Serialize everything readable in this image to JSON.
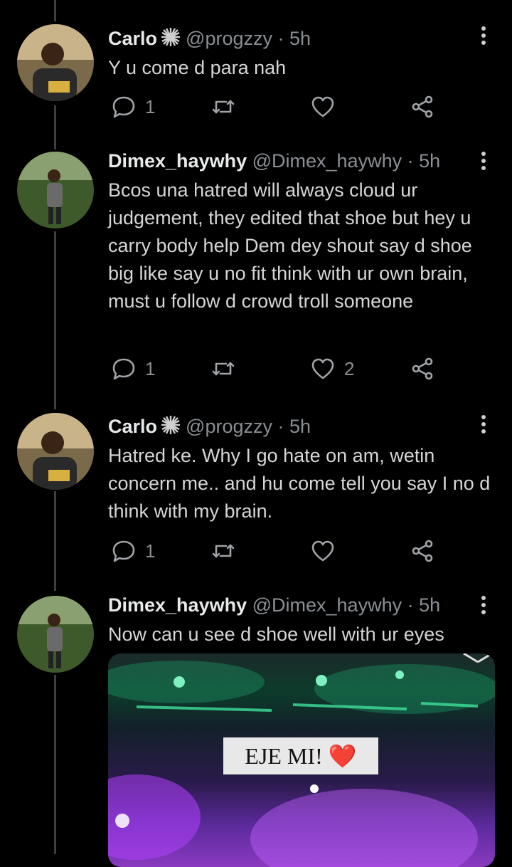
{
  "tweets": [
    {
      "name": "Carlo",
      "handle": "@progzzy",
      "time": "· 5h",
      "text": "Y u come d para nah",
      "replies": "1",
      "retweets": "",
      "likes": ""
    },
    {
      "name": "Dimex_haywhy",
      "handle": "@Dimex_haywhy",
      "time": "· 5h",
      "text": "Bcos una hatred will always cloud ur judgement, they edited that shoe but hey u carry body help Dem dey shout say d shoe big like say u no fit think with ur own brain, must u follow d crowd troll someone",
      "replies": "1",
      "retweets": "",
      "likes": "2"
    },
    {
      "name": "Carlo",
      "handle": "@progzzy",
      "time": "· 5h",
      "text": "Hatred ke.  Why I go hate on am, wetin concern me.. and hu come tell you say I no d think with my brain.",
      "replies": "1",
      "retweets": "",
      "likes": ""
    },
    {
      "name": "Dimex_haywhy",
      "handle": "@Dimex_haywhy",
      "time": "· 5h",
      "text": "Now can u see d shoe well with ur eyes",
      "media_caption": "EJE MI! ❤️"
    }
  ],
  "icons": {
    "reply": "reply-icon",
    "retweet": "retweet-icon",
    "like": "heart-icon",
    "share": "share-icon",
    "more": "more-vertical-icon",
    "badge": "sparkle-badge-icon"
  },
  "colors": {
    "background": "#000000",
    "text": "#d6d6d6",
    "muted": "#8a8f94",
    "thread_line": "#3a3f44"
  }
}
